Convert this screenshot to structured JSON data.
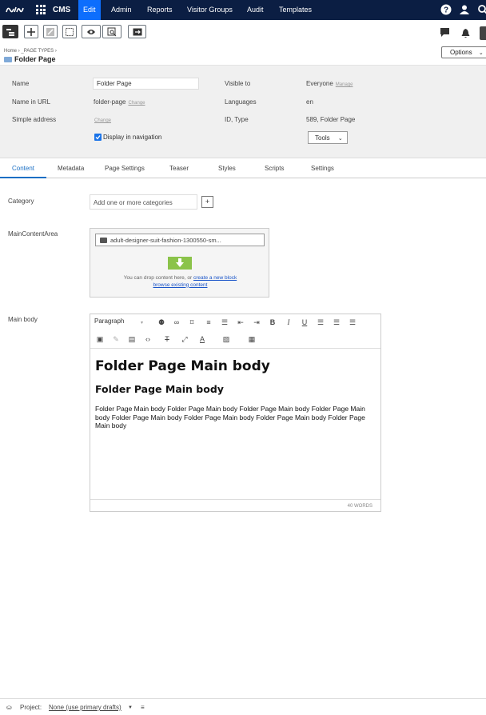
{
  "app": {
    "brand": "CMS"
  },
  "topnav": {
    "items": [
      "Edit",
      "Admin",
      "Reports",
      "Visitor Groups",
      "Audit",
      "Templates"
    ]
  },
  "breadcrumb": {
    "home": "Home",
    "parent": "_PAGE TYPES",
    "sep": "›"
  },
  "page": {
    "title": "Folder Page"
  },
  "header": {
    "options_label": "Options"
  },
  "props": {
    "name_label": "Name",
    "name_value": "Folder Page",
    "url_label": "Name in URL",
    "url_value": "folder-page",
    "url_change": "Change",
    "simple_label": "Simple address",
    "simple_change": "Change",
    "nav_checkbox": "Display in navigation",
    "visible_label": "Visible to",
    "visible_value": "Everyone",
    "visible_manage": "Manage",
    "lang_label": "Languages",
    "lang_value": "en",
    "id_label": "ID, Type",
    "id_value": "589, Folder Page",
    "tools_label": "Tools"
  },
  "tabs": [
    "Content",
    "Metadata",
    "Page Settings",
    "Teaser",
    "Styles",
    "Scripts",
    "Settings"
  ],
  "fields": {
    "category_label": "Category",
    "category_placeholder": "Add one or more categories",
    "mca_label": "MainContentArea",
    "mca_item": "adult-designer-suit-fashion-1300550-sm...",
    "mca_hint": "You can drop content here, or",
    "mca_link1": "create a new block",
    "mca_link2": "browse existing content",
    "mainbody_label": "Main body"
  },
  "editor": {
    "format": "Paragraph",
    "h1": "Folder Page Main body",
    "h2": "Folder Page Main body",
    "body": "Folder Page Main body Folder Page Main body Folder Page Main body Folder Page Main body Folder Page Main body Folder Page Main body Folder Page Main body Folder Page Main body",
    "wordcount": "40 WORDS"
  },
  "footer": {
    "project_label": "Project:",
    "project_value": "None (use primary drafts)"
  },
  "colors": {
    "topnav": "#0b1e43",
    "accent": "#0d6efd",
    "link": "#1a6fc4",
    "drop": "#8bc34a"
  }
}
